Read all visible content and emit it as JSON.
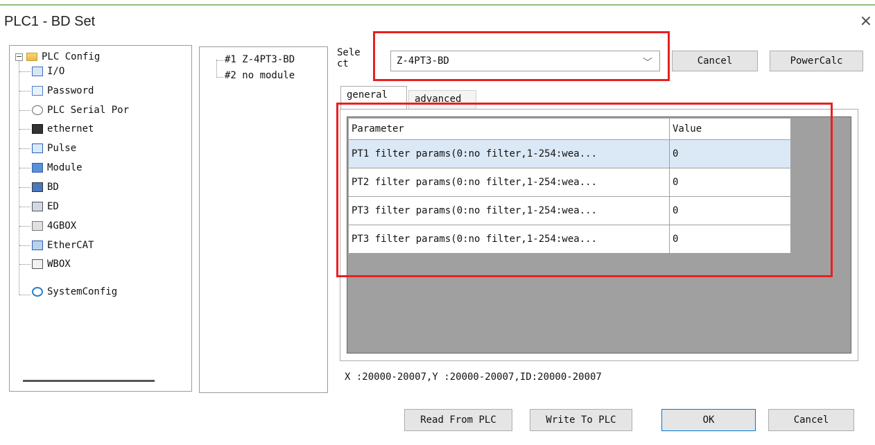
{
  "window": {
    "title": "PLC1 - BD  Set",
    "close_glyph": "×"
  },
  "tree": {
    "root": {
      "label": "PLC Config",
      "icon": "folder-icon",
      "expander": "−"
    },
    "items": [
      {
        "label": "I/O",
        "icon": "io-icon"
      },
      {
        "label": "Password",
        "icon": "password-icon"
      },
      {
        "label": "PLC Serial Por",
        "icon": "serial-port-icon"
      },
      {
        "label": "ethernet",
        "icon": "ethernet-icon"
      },
      {
        "label": "Pulse",
        "icon": "pulse-icon"
      },
      {
        "label": "Module",
        "icon": "module-icon"
      },
      {
        "label": "BD",
        "icon": "bd-icon"
      },
      {
        "label": "ED",
        "icon": "ed-icon"
      },
      {
        "label": "4GBOX",
        "icon": "4gbox-icon"
      },
      {
        "label": "EtherCAT",
        "icon": "ethercat-icon"
      },
      {
        "label": "WBOX",
        "icon": "wbox-icon"
      },
      {
        "label": "SystemConfig",
        "icon": "system-config-icon"
      }
    ]
  },
  "modules": {
    "items": [
      {
        "label": "#1 Z-4PT3-BD"
      },
      {
        "label": "#2 no module"
      }
    ]
  },
  "select": {
    "label": "Select",
    "value": "Z-4PT3-BD",
    "chevron": "﹀"
  },
  "top_buttons": {
    "cancel": "Cancel",
    "power_calc": "PowerCalc"
  },
  "tabs": {
    "general": "general",
    "advanced": "advanced"
  },
  "table": {
    "headers": {
      "parameter": "Parameter",
      "value": "Value"
    },
    "rows": [
      {
        "parameter": "PT1 filter params(0:no filter,1-254:wea...",
        "value": "0"
      },
      {
        "parameter": "PT2 filter params(0:no filter,1-254:wea...",
        "value": "0"
      },
      {
        "parameter": "PT3 filter params(0:no filter,1-254:wea...",
        "value": "0"
      },
      {
        "parameter": "PT3 filter params(0:no filter,1-254:wea...",
        "value": "0"
      }
    ]
  },
  "address": "X :20000-20007,Y :20000-20007,ID:20000-20007",
  "bottom_buttons": {
    "read": "Read From PLC",
    "write": "Write To PLC",
    "ok": "OK",
    "cancel": "Cancel"
  },
  "colors": {
    "highlight_box": "#e82020",
    "selected_row": "#dbe8f5",
    "grid_background": "#a0a0a0"
  }
}
